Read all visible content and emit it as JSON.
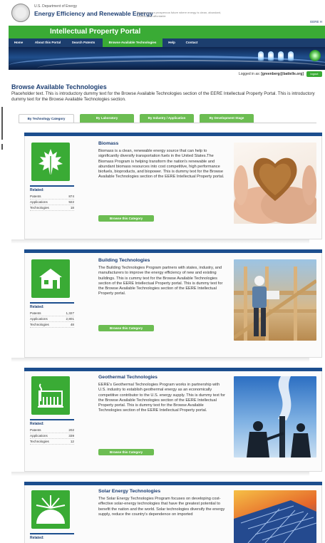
{
  "header": {
    "doe_line": "U.S. Department of Energy",
    "eere_title": "Energy Efficiency and Renewable Energy",
    "tagline": "Bringing you a prosperous future where energy is clean, abundant, reliable, and affordable",
    "eere_link": "EERE H"
  },
  "portal": {
    "title": "Intellectual Property Portal"
  },
  "nav": {
    "items": [
      {
        "label": "Home"
      },
      {
        "label": "About this Portal"
      },
      {
        "label": "Search Patents"
      },
      {
        "label": "Browse Available Technologies"
      },
      {
        "label": "Help"
      },
      {
        "label": "Contact"
      }
    ]
  },
  "session": {
    "logged_in_as": "Logged in as:",
    "user": "[greenberg@battelle.org]",
    "logout_label": "logout"
  },
  "page": {
    "heading": "Browse Available Technologies",
    "intro": "Placeholder text. This is introductory dummy text for the Browse Available Technologies section of the EERE Intellectual Property Portal. This is introductory dummy text for the Browse Available Technologies section."
  },
  "tabs": [
    {
      "label": "By Technology Category"
    },
    {
      "label": "By Laboratory"
    },
    {
      "label": "By Industry / Application"
    },
    {
      "label": "By Development Stage"
    }
  ],
  "related_label": "Related:",
  "row_labels": {
    "patents": "Patents",
    "applications": "Applications",
    "technologies": "Technologies"
  },
  "browse_label": "Browse this Category",
  "categories": [
    {
      "title": "Biomass",
      "text": "Biomass is a clean, renewable energy source that can help to significantly diversify transportation fuels in the United States.The Biomass Program is helping transform the nation's renewable and abundant biomass resources into cost competitive, high performance biofuels, bioproducts, and biopower. This is dummy text for the Browse Available Technologies section of the EERE Intellectual Property portal.",
      "patents": "874",
      "applications": "922",
      "technologies": "18",
      "icon": "leaf-icon"
    },
    {
      "title": "Building Technologies",
      "text": "The Building Technologies Program partners with states, industry, and manufacturers to improve the energy efficiency of new and existing buildings. This is cummy text for the Browse Available Technologies section of the EERE Intellectual Property portal. This is dummy text for the Browse Available Technologies section of the EERE Intellectual Property portal.",
      "patents": "1,327",
      "applications": "2,801",
      "technologies": "48",
      "icon": "house-icon"
    },
    {
      "title": "Geothermal Technologies",
      "text": "EERE's Geothermal Technologies Program works in partnership with U.S. industry to establish geothermal energy as an economically competitive contributor to the U.S. energy supply. This is dummy text for the Browse Available Technologies section of the EERE Intellectual Property portal. This is dummy text for the Browse Available Technologies section of the EERE Intellectual Property portal.",
      "patents": "202",
      "applications": "339",
      "technologies": "12",
      "icon": "geothermal-plant-icon"
    },
    {
      "title": "Solar Energy Technologies",
      "text": "The Solar Energy Technologies Program focuses on developing cost-effective solar-energy technologies that have the greatest potential to benefit the nation and the world. Solar technologies diversify the energy supply, reduce the country's dependence on imported",
      "icon": "sun-icon"
    }
  ],
  "colors": {
    "green": "#3aab35",
    "navy": "#1c3e6e",
    "card_bar": "#1c4e8e",
    "button_green": "#6cbd52"
  }
}
